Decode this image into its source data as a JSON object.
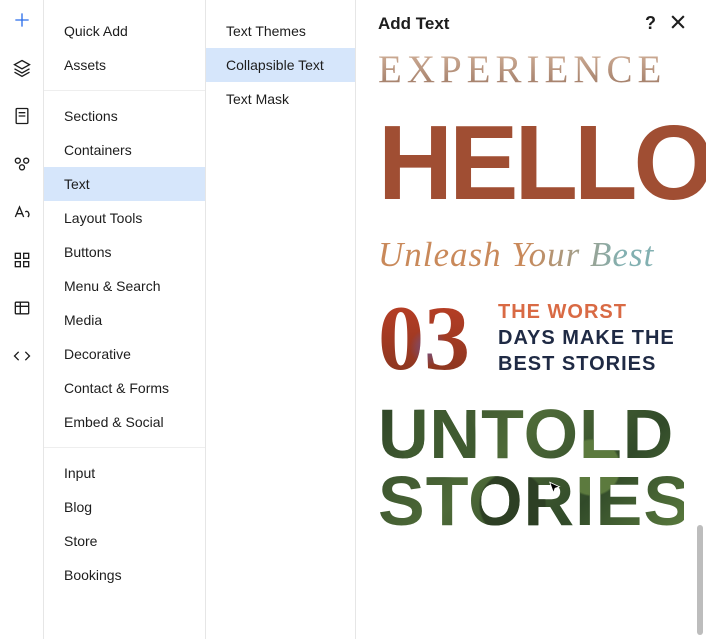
{
  "panel_title": "Add Text",
  "icon_rail": [
    {
      "name": "add-icon",
      "active": true
    },
    {
      "name": "layers-icon",
      "active": false
    },
    {
      "name": "pages-icon",
      "active": false
    },
    {
      "name": "people-icon",
      "active": false
    },
    {
      "name": "text-style-icon",
      "active": false
    },
    {
      "name": "apps-icon",
      "active": false
    },
    {
      "name": "data-icon",
      "active": false
    },
    {
      "name": "dev-icon",
      "active": false
    }
  ],
  "categories": [
    {
      "group": 0,
      "label": "Quick Add"
    },
    {
      "group": 0,
      "label": "Assets"
    },
    {
      "group": 1,
      "label": "Sections"
    },
    {
      "group": 1,
      "label": "Containers"
    },
    {
      "group": 1,
      "label": "Text",
      "selected": true
    },
    {
      "group": 1,
      "label": "Layout Tools"
    },
    {
      "group": 1,
      "label": "Buttons"
    },
    {
      "group": 1,
      "label": "Menu & Search"
    },
    {
      "group": 1,
      "label": "Media"
    },
    {
      "group": 1,
      "label": "Decorative"
    },
    {
      "group": 1,
      "label": "Contact & Forms"
    },
    {
      "group": 1,
      "label": "Embed & Social"
    },
    {
      "group": 2,
      "label": "Input"
    },
    {
      "group": 2,
      "label": "Blog"
    },
    {
      "group": 2,
      "label": "Store"
    },
    {
      "group": 2,
      "label": "Bookings"
    }
  ],
  "subcategories": [
    {
      "label": "Text Themes"
    },
    {
      "label": "Collapsible Text",
      "selected": true
    },
    {
      "label": "Text Mask"
    }
  ],
  "samples": {
    "experience": "EXPERIENCE",
    "hello": "HELLO",
    "unleash": "Unleash Your Best",
    "number": "03",
    "worst_line1": "THE WORST",
    "worst_line2a": "DAYS MAKE THE",
    "worst_line2b": "BEST STORIES",
    "untold_line1": "UNTOLD",
    "untold_line2": "STORIES"
  }
}
